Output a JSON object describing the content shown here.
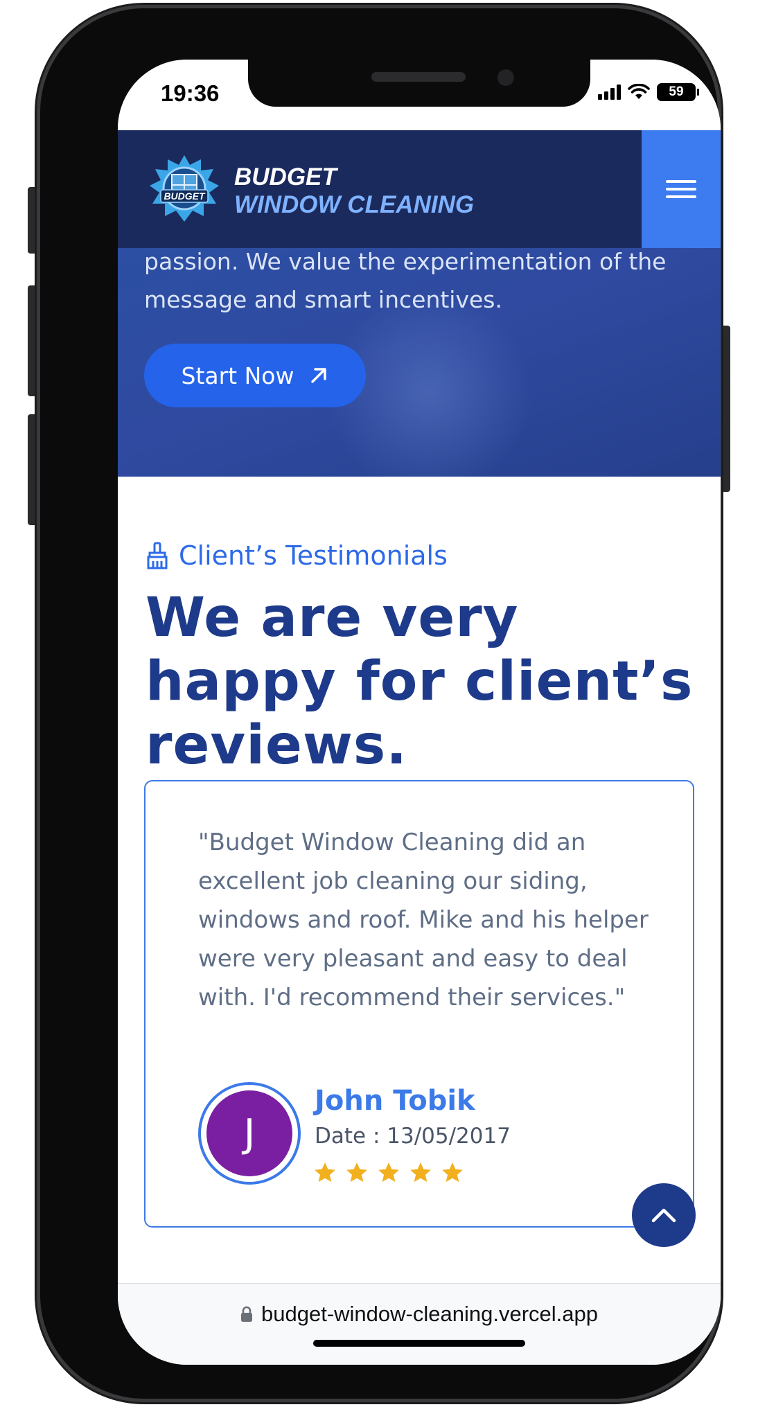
{
  "statusbar": {
    "time": "19:36",
    "battery": "59",
    "icons": [
      "signal-icon",
      "wifi-icon",
      "battery-icon"
    ]
  },
  "navbar": {
    "logo_badge_text": "BUDGET",
    "logo_line1": "BUDGET",
    "logo_line2": "WINDOW CLEANING",
    "menu_icon": "hamburger-menu-icon"
  },
  "hero": {
    "text": "passion. We value the experimentation of the message and smart incentives.",
    "start_label": "Start Now",
    "start_icon": "arrow-up-right-icon"
  },
  "testimonials": {
    "tag": "Client’s Testimonials",
    "tag_icon": "brush-icon",
    "title": "We are very happy for client’s reviews.",
    "review": {
      "quote": "\"Budget Window Cleaning did an excellent job cleaning our siding, windows and roof. Mike and his helper were very pleasant and easy to deal with. I'd recommend their services.\"",
      "avatar_letter": "J",
      "name": "John Tobik",
      "date": "Date : 13/05/2017",
      "rating": 5,
      "rating_max": 5
    }
  },
  "scroll_top_icon": "chevron-up-icon",
  "urlbar": {
    "url": "budget-window-cleaning.vercel.app",
    "lock_icon": "lock-icon"
  },
  "colors": {
    "navy": "#1b2a5c",
    "brand_blue": "#2563eb",
    "menu_blue": "#3d7bf0",
    "title_blue": "#1e3a8a",
    "avatar_purple": "#7b1fa2",
    "star_gold": "#f2b01e"
  }
}
